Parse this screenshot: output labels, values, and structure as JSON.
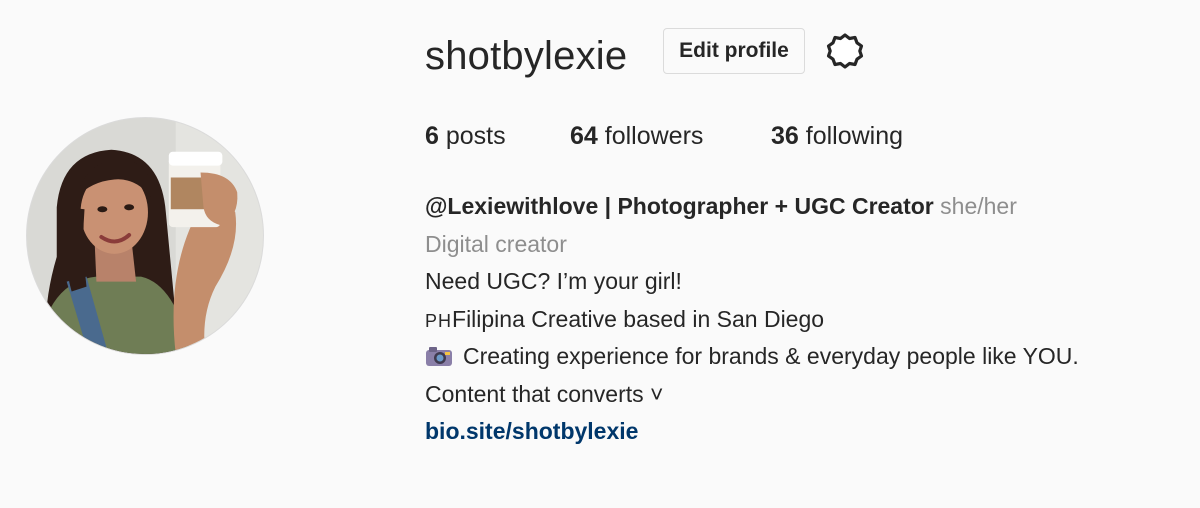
{
  "profile": {
    "username": "shotbylexie",
    "edit_button_label": "Edit profile",
    "settings_icon": "gear-icon",
    "avatar_icon": "profile-photo"
  },
  "stats": {
    "posts_count": "6",
    "posts_label": "posts",
    "followers_count": "64",
    "followers_label": "followers",
    "following_count": "36",
    "following_label": "following"
  },
  "bio": {
    "full_name": "@Lexiewithlove | Photographer + UGC Creator",
    "pronouns": "she/her",
    "category": "Digital creator",
    "line1": "Need UGC? I’m your girl!",
    "line2_flag": "PH",
    "line2_text": "Filipina Creative based in San Diego",
    "line3_icon": "camera-icon",
    "line3_text": "Creating experience for brands & everyday people like YOU.",
    "line4": "Content that converts ˅",
    "link": "bio.site/shotbylexie"
  },
  "colors": {
    "background": "#fafafa",
    "text_primary": "#262626",
    "text_secondary": "#8e8e8e",
    "link": "#00376b",
    "border": "#dbdbdb"
  }
}
